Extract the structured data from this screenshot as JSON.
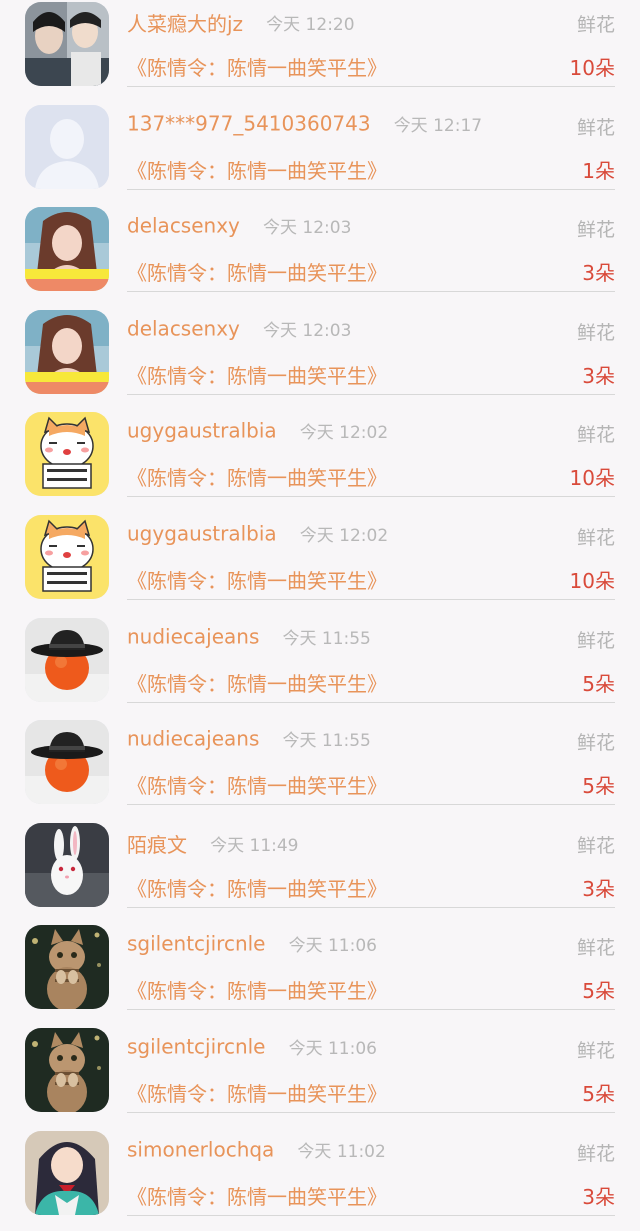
{
  "colors": {
    "name": "#e8945a",
    "time": "#b8b8b8",
    "count": "#d94a3a",
    "gift_type": "#b5b5b5",
    "background": "#f8f6f8"
  },
  "rows": [
    {
      "avatar": "drama-stills-avatar",
      "name": "人菜瘾大的jz",
      "time": "今天 12:20",
      "gift_type": "鲜花",
      "book": "《陈情令：陈情一曲笑平生》",
      "count": "10朵"
    },
    {
      "avatar": "default-person-avatar",
      "name": "137***977_5410360743",
      "time": "今天 12:17",
      "gift_type": "鲜花",
      "book": "《陈情令：陈情一曲笑平生》",
      "count": "1朵"
    },
    {
      "avatar": "woman-photo-avatar",
      "name": "delacsenxy",
      "time": "今天 12:03",
      "gift_type": "鲜花",
      "book": "《陈情令：陈情一曲笑平生》",
      "count": "3朵"
    },
    {
      "avatar": "woman-photo-avatar",
      "name": "delacsenxy",
      "time": "今天 12:03",
      "gift_type": "鲜花",
      "book": "《陈情令：陈情一曲笑平生》",
      "count": "3朵"
    },
    {
      "avatar": "cartoon-cat-sign-avatar",
      "name": "ugygaustralbia",
      "time": "今天 12:02",
      "gift_type": "鲜花",
      "book": "《陈情令：陈情一曲笑平生》",
      "count": "10朵"
    },
    {
      "avatar": "cartoon-cat-sign-avatar",
      "name": "ugygaustralbia",
      "time": "今天 12:02",
      "gift_type": "鲜花",
      "book": "《陈情令：陈情一曲笑平生》",
      "count": "10朵"
    },
    {
      "avatar": "orange-with-hat-avatar",
      "name": "nudiecajeans",
      "time": "今天 11:55",
      "gift_type": "鲜花",
      "book": "《陈情令：陈情一曲笑平生》",
      "count": "5朵"
    },
    {
      "avatar": "orange-with-hat-avatar",
      "name": "nudiecajeans",
      "time": "今天 11:55",
      "gift_type": "鲜花",
      "book": "《陈情令：陈情一曲笑平生》",
      "count": "5朵"
    },
    {
      "avatar": "white-rabbit-avatar",
      "name": "陌痕文",
      "time": "今天 11:49",
      "gift_type": "鲜花",
      "book": "《陈情令：陈情一曲笑平生》",
      "count": "3朵"
    },
    {
      "avatar": "tabby-kitten-avatar",
      "name": "sgilentcjircnle",
      "time": "今天 11:06",
      "gift_type": "鲜花",
      "book": "《陈情令：陈情一曲笑平生》",
      "count": "5朵"
    },
    {
      "avatar": "tabby-kitten-avatar",
      "name": "sgilentcjircnle",
      "time": "今天 11:06",
      "gift_type": "鲜花",
      "book": "《陈情令：陈情一曲笑平生》",
      "count": "5朵"
    },
    {
      "avatar": "anime-girl-avatar",
      "name": "simonerlochqa",
      "time": "今天 11:02",
      "gift_type": "鲜花",
      "book": "《陈情令：陈情一曲笑平生》",
      "count": "3朵"
    }
  ]
}
